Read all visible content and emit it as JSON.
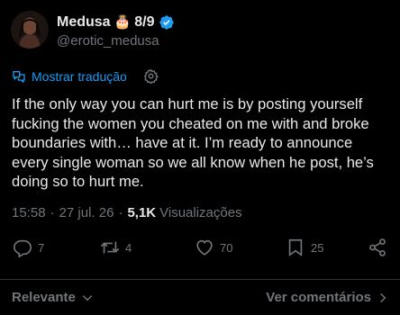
{
  "author": {
    "display_name": "Medusa",
    "emoji": "🎂",
    "date_badge": "8/9",
    "handle": "@erotic_medusa"
  },
  "translate": {
    "label": "Mostrar tradução"
  },
  "post": {
    "text": "If the only way you can hurt me is by posting yourself fucking the women you cheated on me with and broke boundaries with… have at it. I’m ready to announce every single woman so we all know when he post, he’s doing so to hurt me."
  },
  "meta": {
    "time": "15:58",
    "date": "27 jul. 26",
    "views_count": "5,1K",
    "views_label": "Visualizações"
  },
  "actions": {
    "replies": "7",
    "reposts": "4",
    "likes": "70",
    "bookmarks": "25"
  },
  "footer": {
    "sort_label": "Relevante",
    "comments_label": "Ver comentários"
  },
  "colors": {
    "background": "#000000",
    "text": "#e7e9ea",
    "muted": "#71767b",
    "accent": "#1d9bf0"
  }
}
